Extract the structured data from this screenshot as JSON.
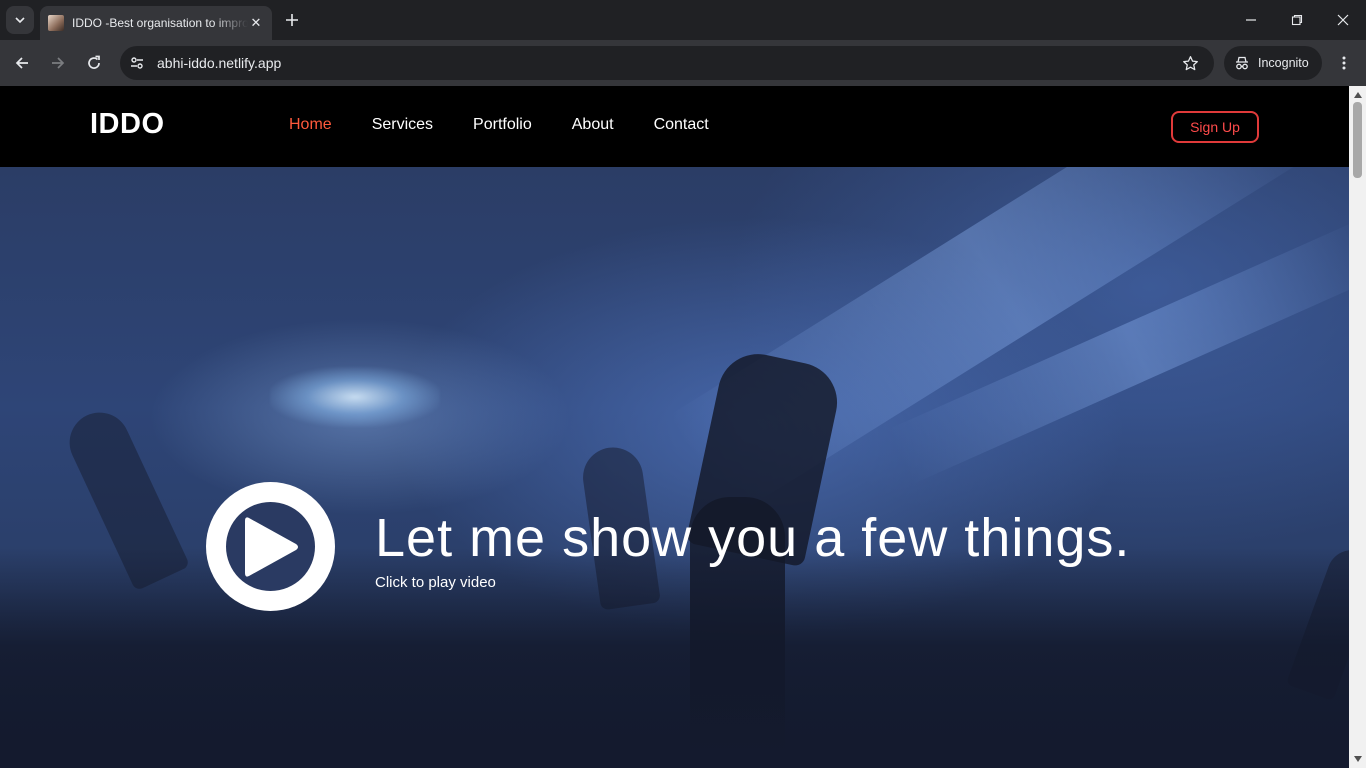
{
  "browser": {
    "tab": {
      "title": "IDDO -Best organisation to improve"
    },
    "address": {
      "url": "abhi-iddo.netlify.app"
    },
    "profile": {
      "label": "Incognito"
    }
  },
  "site": {
    "logo": "IDDO",
    "nav": [
      {
        "label": "Home",
        "active": true
      },
      {
        "label": "Services",
        "active": false
      },
      {
        "label": "Portfolio",
        "active": false
      },
      {
        "label": "About",
        "active": false
      },
      {
        "label": "Contact",
        "active": false
      }
    ],
    "signup_label": "Sign Up",
    "hero": {
      "headline": "Let me show you a few things.",
      "subtext": "Click to play video"
    }
  },
  "colors": {
    "accent": "#ff5a3c",
    "signup_border": "#e03a3a",
    "nav_bg": "#000000",
    "hero_blue": "#2e4577"
  }
}
